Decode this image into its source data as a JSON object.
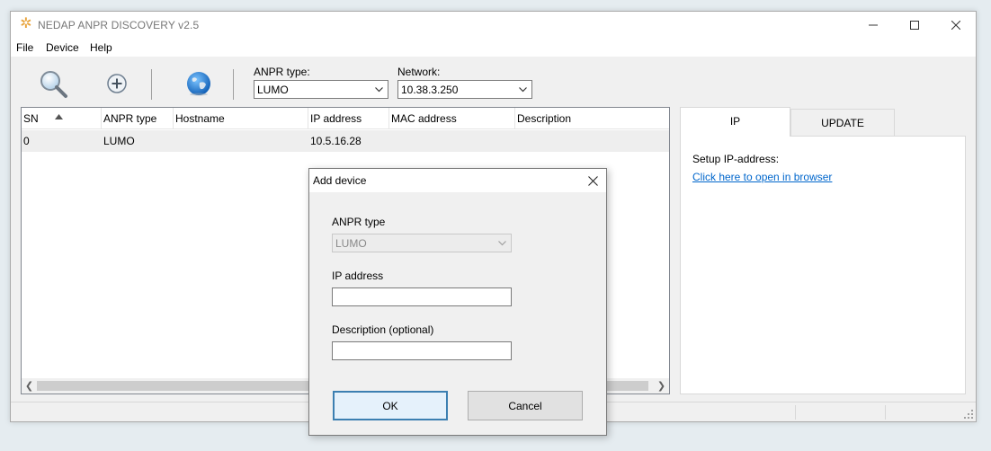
{
  "window": {
    "title": "NEDAP ANPR DISCOVERY v2.5",
    "controls": {
      "minimize": "minimize-icon",
      "maximize": "maximize-icon",
      "close": "close-icon"
    }
  },
  "menu": {
    "items": [
      {
        "label": "File"
      },
      {
        "label": "Device"
      },
      {
        "label": "Help"
      }
    ]
  },
  "toolbar": {
    "buttons": [
      {
        "icon": "search-icon"
      },
      {
        "icon": "add-icon"
      },
      {
        "icon": "globe-icon"
      }
    ],
    "anpr_type": {
      "label": "ANPR type:",
      "value": "LUMO"
    },
    "network": {
      "label": "Network:",
      "value": "10.38.3.250"
    }
  },
  "device_list": {
    "columns": [
      {
        "label": "SN"
      },
      {
        "label": "ANPR type"
      },
      {
        "label": "Hostname"
      },
      {
        "label": "IP address"
      },
      {
        "label": "MAC address"
      },
      {
        "label": "Description"
      }
    ],
    "rows": [
      {
        "sn": "0",
        "anpr_type": "LUMO",
        "hostname": "",
        "ip": "10.5.16.28",
        "mac": "",
        "description": ""
      }
    ]
  },
  "side_panel": {
    "tabs": [
      {
        "label": "IP"
      },
      {
        "label": "UPDATE"
      }
    ],
    "setup_label": "Setup IP-address:",
    "link": "Click here to open in browser"
  },
  "dialog": {
    "title": "Add device",
    "anpr_type_label": "ANPR type",
    "anpr_type_value": "LUMO",
    "ip_label": "IP address",
    "ip_value": "",
    "description_label": "Description (optional)",
    "description_value": "",
    "ok": "OK",
    "cancel": "Cancel"
  },
  "colors": {
    "accent": "#3c7fb1",
    "link": "#0066cc",
    "app_icon": "#e8a33a"
  }
}
